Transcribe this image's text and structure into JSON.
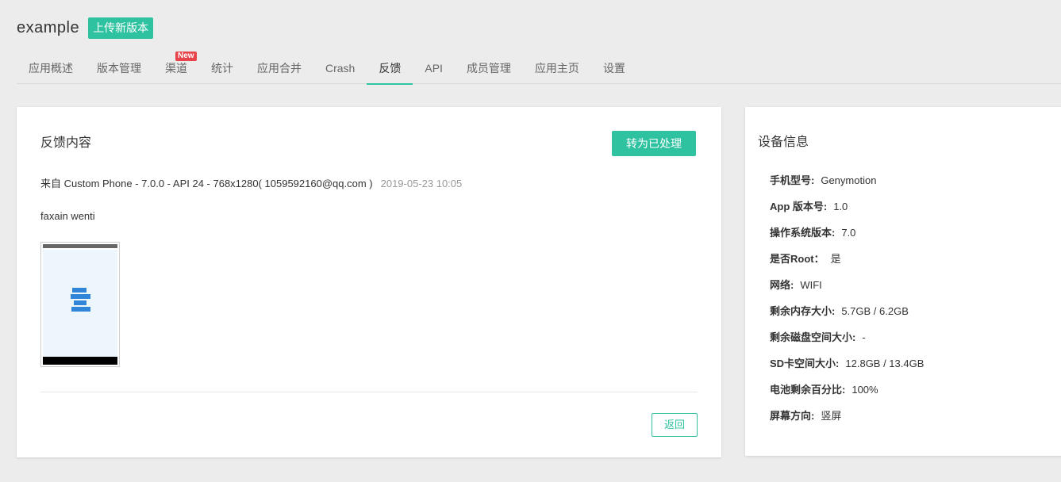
{
  "header": {
    "app_name": "example",
    "upload_label": "上传新版本"
  },
  "tabs": [
    {
      "label": "应用概述"
    },
    {
      "label": "版本管理"
    },
    {
      "label": "渠道",
      "badge": "New"
    },
    {
      "label": "统计"
    },
    {
      "label": "应用合并"
    },
    {
      "label": "Crash"
    },
    {
      "label": "反馈",
      "active": true
    },
    {
      "label": "API"
    },
    {
      "label": "成员管理"
    },
    {
      "label": "应用主页"
    },
    {
      "label": "设置"
    }
  ],
  "feedback": {
    "title": "反馈内容",
    "mark_processed_label": "转为已处理",
    "source": "来自 Custom Phone - 7.0.0 - API 24 - 768x1280( 1059592160@qq.com )",
    "time": "2019-05-23 10:05",
    "message": "faxain wenti",
    "back_label": "返回"
  },
  "device": {
    "title": "设备信息",
    "items": [
      {
        "key": "手机型号:",
        "value": "Genymotion"
      },
      {
        "key": "App 版本号:",
        "value": "1.0"
      },
      {
        "key": "操作系统版本:",
        "value": "7.0"
      },
      {
        "key": "是否Root：",
        "value": "是"
      },
      {
        "key": "网络:",
        "value": "WIFI"
      },
      {
        "key": "剩余内存大小:",
        "value": "5.7GB / 6.2GB"
      },
      {
        "key": "剩余磁盘空间大小:",
        "value": "-"
      },
      {
        "key": "SD卡空间大小:",
        "value": "12.8GB / 13.4GB"
      },
      {
        "key": "电池剩余百分比:",
        "value": "100%"
      },
      {
        "key": "屏幕方向:",
        "value": "竖屏"
      }
    ]
  },
  "colors": {
    "accent": "#2fc2a0",
    "badge": "#e8434a",
    "background": "#ececec"
  }
}
